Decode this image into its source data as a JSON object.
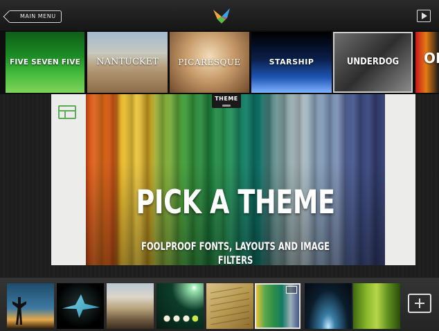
{
  "header": {
    "back_label": "MAIN MENU"
  },
  "theme_strip": [
    {
      "title": "FIVE SEVEN FIVE"
    },
    {
      "title": "NANTUCKET"
    },
    {
      "title": "PICARESQUE"
    },
    {
      "title": "STARSHIP"
    },
    {
      "title": "UNDERDOG",
      "selected": true
    },
    {
      "title": "OI"
    }
  ],
  "canvas": {
    "tab_label": "THEME",
    "headline": "PICK A THEME",
    "subline": "FOOLPROOF FONTS, LAYOUTS AND IMAGE FILTERS"
  },
  "filmstrip": {
    "selected_index": 5,
    "count_visible": 8
  },
  "icons": {
    "back": "back-arrow-icon",
    "logo": "app-logo-icon",
    "play": "play-icon",
    "layout": "layout-icon",
    "add": "add-icon"
  },
  "colors": {
    "accent": "#5bab57",
    "bar": "#1b1b1b"
  }
}
